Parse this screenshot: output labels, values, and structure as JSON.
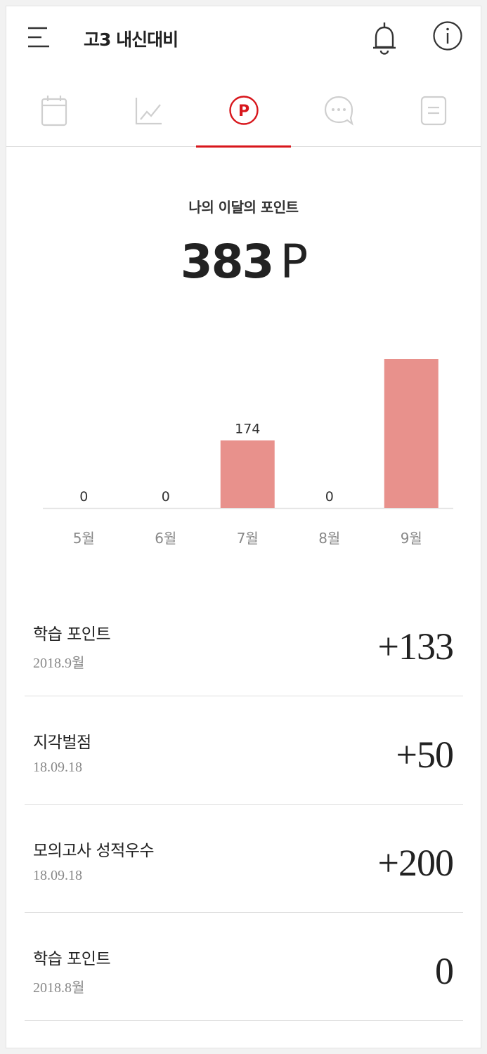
{
  "header": {
    "title": "고3 내신대비"
  },
  "tabs": [
    {
      "icon": "calendar-icon",
      "active": false
    },
    {
      "icon": "line-chart-icon",
      "active": false
    },
    {
      "icon": "points-icon",
      "label": "P",
      "active": true
    },
    {
      "icon": "chat-bubble-icon",
      "active": false
    },
    {
      "icon": "document-icon",
      "active": false
    }
  ],
  "summary": {
    "label": "나의 이달의 포인트",
    "value": "383",
    "unit": "P"
  },
  "chart_data": {
    "type": "bar",
    "categories": [
      "5월",
      "6월",
      "7월",
      "8월",
      "9월"
    ],
    "values": [
      0,
      0,
      174,
      0,
      383
    ],
    "data_labels": [
      "0",
      "0",
      "174",
      "0",
      ""
    ],
    "bar_color": "#e8918c"
  },
  "points_list": [
    {
      "title": "학습 포인트",
      "date": "2018.9월",
      "value": "+133"
    },
    {
      "title": "지각벌점",
      "date": "18.09.18",
      "value": "+50"
    },
    {
      "title": "모의고사 성적우수",
      "date": "18.09.18",
      "value": "+200"
    },
    {
      "title": "학습 포인트",
      "date": "2018.8월",
      "value": "0"
    }
  ],
  "colors": {
    "accent": "#d8161c",
    "bar": "#e8918c",
    "icon_inactive": "#cfcfcf"
  }
}
